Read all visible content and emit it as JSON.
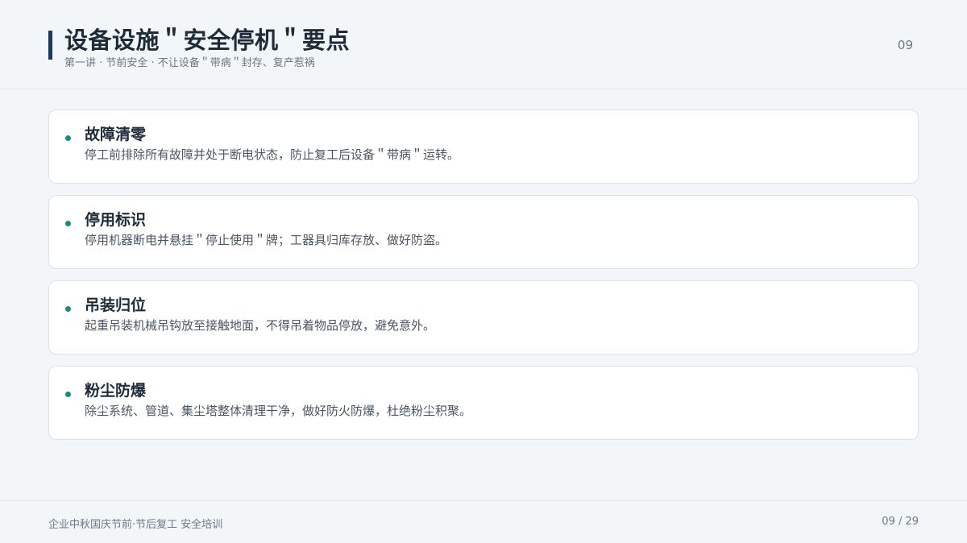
{
  "header": {
    "title": "设备设施＂安全停机＂要点",
    "subtitle": "第一讲 · 节前安全 · 不让设备＂带病＂封存、复产惹祸",
    "page_number": "09"
  },
  "cards": [
    {
      "title": "故障清零",
      "description": "停工前排除所有故障并处于断电状态，防止复工后设备＂带病＂运转。"
    },
    {
      "title": "停用标识",
      "description": "停用机器断电并悬挂＂停止使用＂牌；工器具归库存放、做好防盗。"
    },
    {
      "title": "吊装归位",
      "description": "起重吊装机械吊钩放至接触地面，不得吊着物品停放，避免意外。"
    },
    {
      "title": "粉尘防爆",
      "description": "除尘系统、管道、集尘塔整体清理干净，做好防火防爆，杜绝粉尘积聚。"
    }
  ],
  "footer": {
    "left_text": "企业中秋国庆节前·节后复工 安全培训",
    "page_indicator": "09 / 29"
  },
  "colors": {
    "accent_bar": "#1e3a5a",
    "bullet": "#1a8a7c",
    "background": "#f3f6f9",
    "card_background": "#ffffff"
  }
}
